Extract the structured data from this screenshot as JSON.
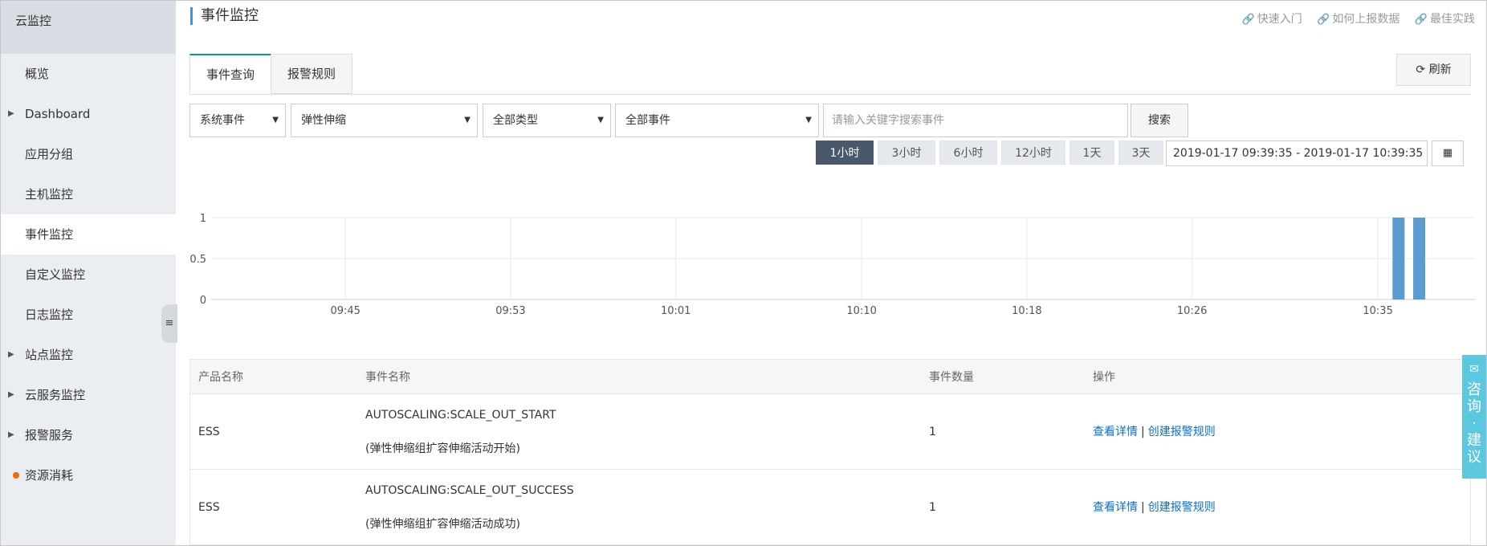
{
  "sidebar": {
    "title": "云监控",
    "items": [
      {
        "label": "概览",
        "expandable": false,
        "active": false
      },
      {
        "label": "Dashboard",
        "expandable": true,
        "active": false
      },
      {
        "label": "应用分组",
        "expandable": false,
        "active": false
      },
      {
        "label": "主机监控",
        "expandable": false,
        "active": false
      },
      {
        "label": "事件监控",
        "expandable": false,
        "active": true
      },
      {
        "label": "自定义监控",
        "expandable": false,
        "active": false
      },
      {
        "label": "日志监控",
        "expandable": false,
        "active": false
      },
      {
        "label": "站点监控",
        "expandable": true,
        "active": false
      },
      {
        "label": "云服务监控",
        "expandable": true,
        "active": false
      },
      {
        "label": "报警服务",
        "expandable": true,
        "active": false
      },
      {
        "label": "资源消耗",
        "expandable": false,
        "active": false,
        "dot_color": "#ff6600"
      }
    ]
  },
  "header": {
    "title": "事件监控",
    "links": [
      "快速入门",
      "如何上报数据",
      "最佳实践"
    ]
  },
  "tabs": [
    "事件查询",
    "报警规则"
  ],
  "refresh_label": "刷新",
  "filters": {
    "event_source": "系统事件",
    "product": "弹性伸缩",
    "type": "全部类型",
    "event": "全部事件",
    "search_placeholder": "请输入关键字搜索事件",
    "search_label": "搜索"
  },
  "time_ranges": [
    "1小时",
    "3小时",
    "6小时",
    "12小时",
    "1天",
    "3天"
  ],
  "active_time_range": "1小时",
  "date_range": "2019-01-17 09:39:35 - 2019-01-17 10:39:35",
  "chart_data": {
    "type": "bar",
    "x_ticks": [
      "09:45",
      "09:53",
      "10:01",
      "10:10",
      "10:18",
      "10:26",
      "10:35"
    ],
    "y_ticks": [
      "0",
      "0.5",
      "1"
    ],
    "ylim": [
      0,
      1
    ],
    "bars": [
      {
        "x": "10:36",
        "value": 1
      },
      {
        "x": "10:37",
        "value": 1
      }
    ],
    "bar_color": "#5b9bd0",
    "grid": true
  },
  "table": {
    "headers": [
      "产品名称",
      "事件名称",
      "事件数量",
      "操作"
    ],
    "rows": [
      {
        "product": "ESS",
        "event": "AUTOSCALING:SCALE_OUT_START",
        "event_desc": "(弹性伸缩组扩容伸缩活动开始)",
        "count": "1",
        "action_detail": "查看详情",
        "action_rule": "创建报警规则"
      },
      {
        "product": "ESS",
        "event": "AUTOSCALING:SCALE_OUT_SUCCESS",
        "event_desc": "(弹性伸缩组扩容伸缩活动成功)",
        "count": "1",
        "action_detail": "查看详情",
        "action_rule": "创建报警规则"
      }
    ],
    "separator": "|"
  },
  "consult_label": "咨询·建议"
}
